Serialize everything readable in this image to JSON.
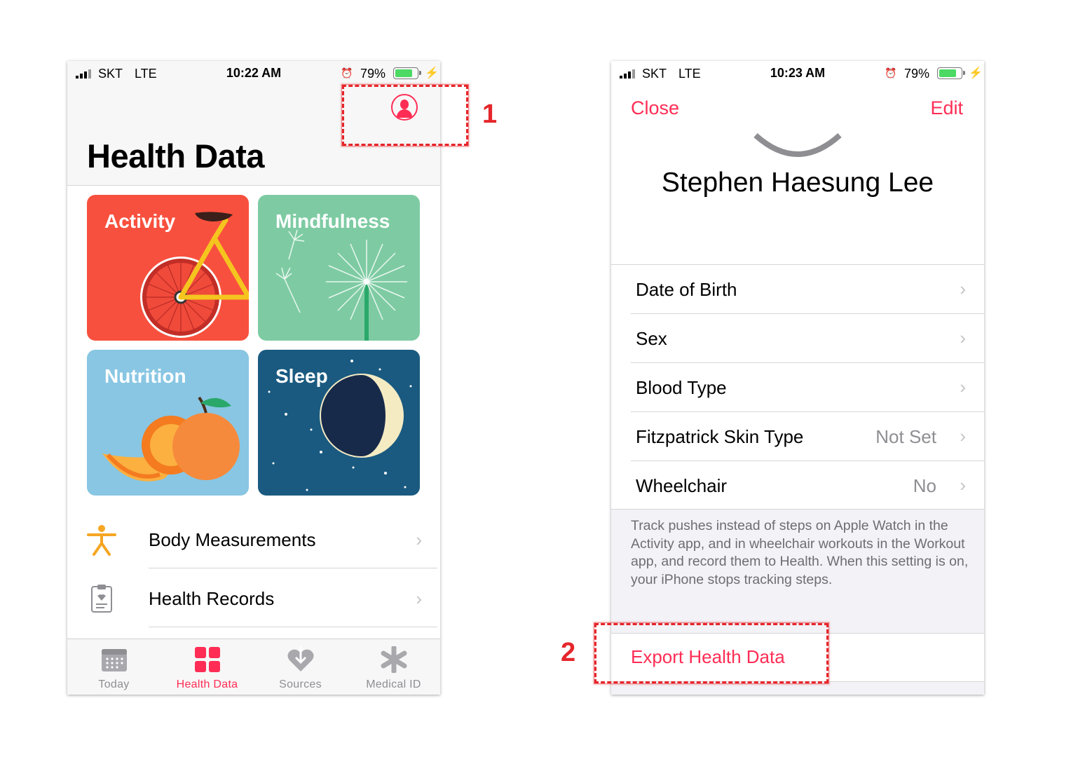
{
  "left_phone": {
    "status": {
      "carrier": "SKT",
      "network": "LTE",
      "time": "10:22 AM",
      "battery": "79%",
      "battery_level": 0.79
    },
    "title": "Health Data",
    "tiles": [
      {
        "label": "Activity",
        "color": "#f8503e"
      },
      {
        "label": "Mindfulness",
        "color": "#7ecba3"
      },
      {
        "label": "Nutrition",
        "color": "#88c6e3"
      },
      {
        "label": "Sleep",
        "color": "#1a5a80"
      }
    ],
    "rows": [
      {
        "label": "Body Measurements",
        "icon": "figure-icon"
      },
      {
        "label": "Health Records",
        "icon": "clipboard-icon"
      }
    ],
    "tabs": [
      {
        "label": "Today",
        "icon": "calendar-icon",
        "active": false
      },
      {
        "label": "Health Data",
        "icon": "grid-icon",
        "active": true
      },
      {
        "label": "Sources",
        "icon": "heart-download-icon",
        "active": false
      },
      {
        "label": "Medical ID",
        "icon": "asterisk-icon",
        "active": false
      }
    ]
  },
  "right_phone": {
    "status": {
      "carrier": "SKT",
      "network": "LTE",
      "time": "10:23 AM",
      "battery": "79%",
      "battery_level": 0.79
    },
    "nav": {
      "close": "Close",
      "edit": "Edit"
    },
    "name": "Stephen Haesung Lee",
    "fields": [
      {
        "label": "Date of Birth",
        "value": ""
      },
      {
        "label": "Sex",
        "value": ""
      },
      {
        "label": "Blood Type",
        "value": ""
      },
      {
        "label": "Fitzpatrick Skin Type",
        "value": "Not Set"
      },
      {
        "label": "Wheelchair",
        "value": "No"
      }
    ],
    "footnote": "Track pushes instead of steps on Apple Watch in the Activity app, and in wheelchair workouts in the Workout app, and record them to Health. When this setting is on, your iPhone stops tracking steps.",
    "export": "Export Health Data"
  },
  "annotations": [
    "1",
    "2"
  ],
  "colors": {
    "accent": "#ff2d55",
    "annotation": "#e5262b"
  }
}
